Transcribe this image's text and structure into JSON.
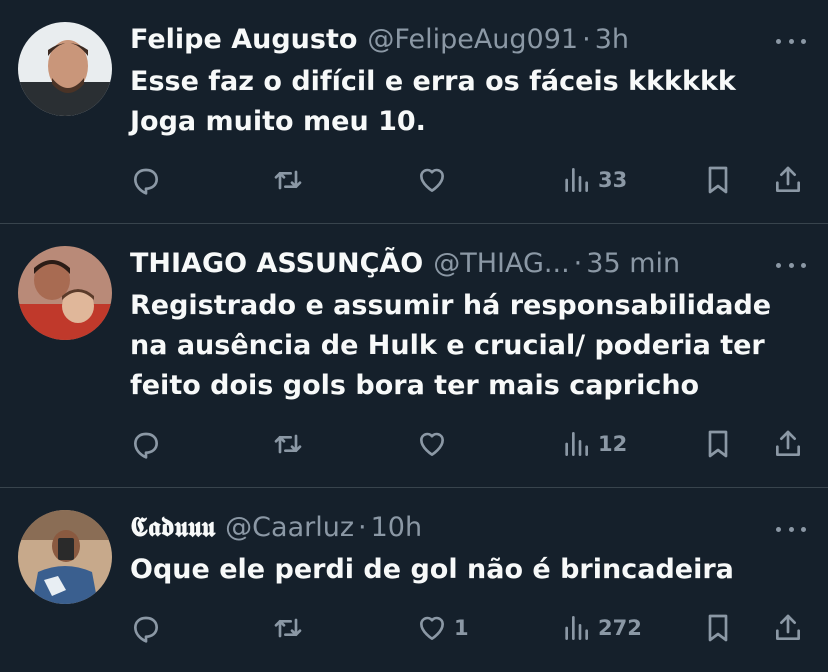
{
  "tweets": [
    {
      "name": "Felipe Augusto",
      "handle": "@FelipeAug091",
      "separator": "·",
      "time": "3h",
      "text": "Esse faz o difícil e erra os fáceis kkkkkk\nJoga muito meu 10.",
      "likes": "",
      "views": "33"
    },
    {
      "name": "THIAGO ASSUNÇÃO",
      "handle": "@THIAG...",
      "separator": "·",
      "time": "35 min",
      "text": "Registrado e assumir há responsabilidade\nna ausência de Hulk e crucial/ poderia ter\nfeito dois gols bora ter mais capricho",
      "likes": "",
      "views": "12"
    },
    {
      "name": "𝕮𝖆𝖉𝖚𝖚𝖚",
      "handle": "@Caarluz",
      "separator": "·",
      "time": "10h",
      "text": "Oque ele perdi de gol não é brincadeira",
      "likes": "1",
      "views": "272"
    }
  ],
  "icons": {
    "reply": "reply-icon",
    "retweet": "retweet-icon",
    "like": "heart-icon",
    "views": "views-icon",
    "bookmark": "bookmark-icon",
    "share": "share-icon",
    "more": "more-icon"
  },
  "colors": {
    "background": "#15202b",
    "text": "#f7f9f9",
    "secondary": "#8b98a5",
    "divider": "#38444d"
  }
}
